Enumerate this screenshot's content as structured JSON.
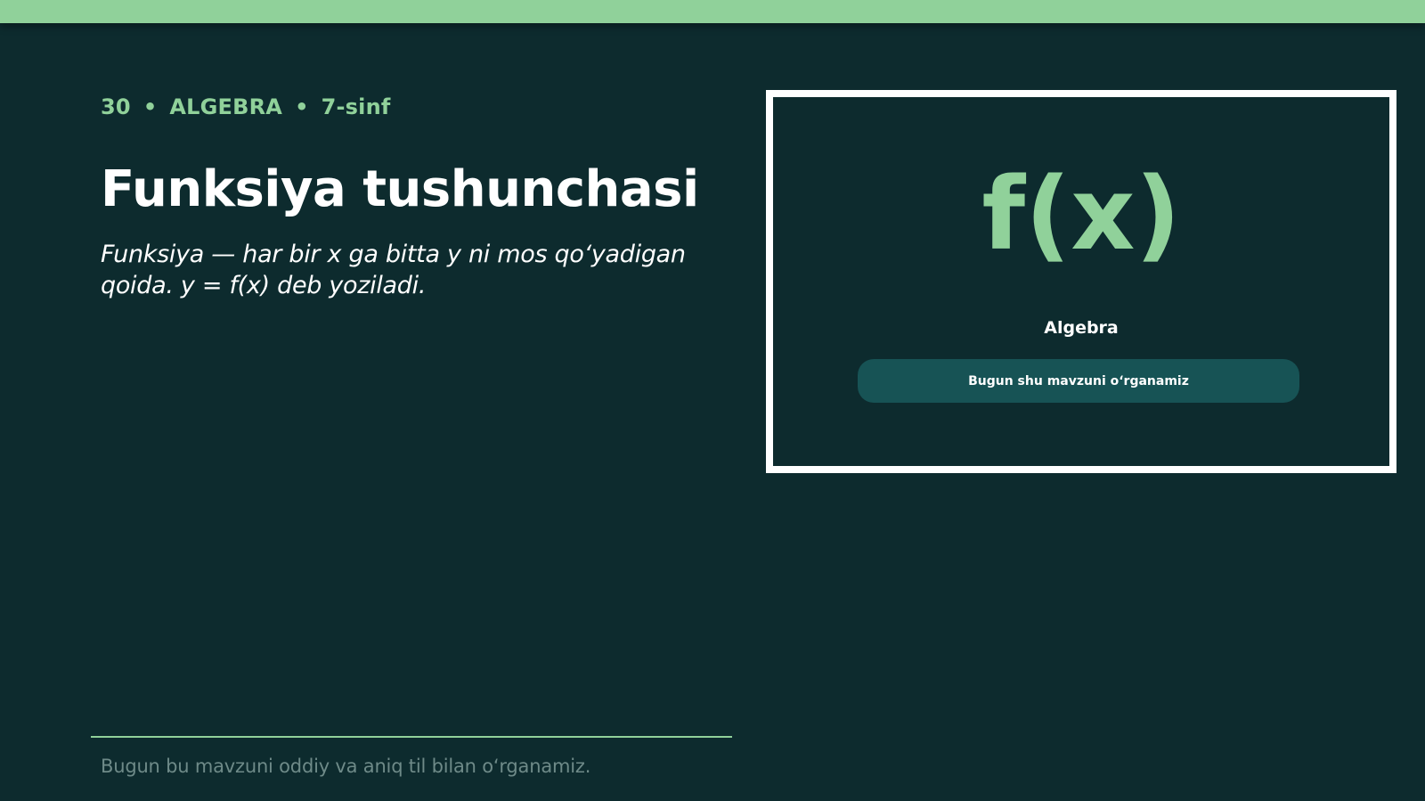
{
  "slide": {
    "number": "30",
    "subject": "ALGEBRA",
    "grade": "7-sinf",
    "separator": "•",
    "title": "Funksiya tushunchasi",
    "lead": "Funksiya — har bir x ga bitta y ni mos qo‘yadigan qoida. y = f(x) deb yoziladi.",
    "footer": "Bugun bu mavzuni oddiy va aniq til bilan o‘rganamiz."
  },
  "card": {
    "symbol": "f(x)",
    "subject": "Algebra",
    "button_label": "Bugun shu mavzuni o‘rganamiz"
  },
  "colors": {
    "background": "#0d2b2e",
    "accent": "#90d19a",
    "button": "#175355",
    "text": "#ffffff",
    "muted": "#6e8a88"
  }
}
